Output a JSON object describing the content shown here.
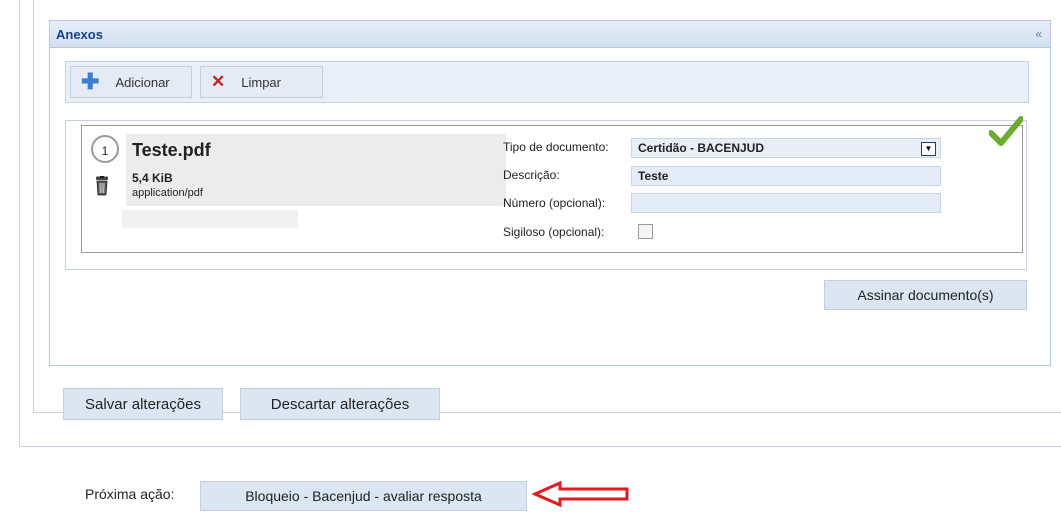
{
  "panel": {
    "title": "Anexos",
    "collapse_symbol": "«"
  },
  "toolbar": {
    "add_label": "Adicionar",
    "clear_label": "Limpar"
  },
  "file": {
    "index": "1",
    "name": "Teste.pdf",
    "size": "5,4 KiB",
    "mime": "application/pdf"
  },
  "form": {
    "doc_type_label": "Tipo de documento:",
    "doc_type_value": "Certidão - BACENJUD",
    "description_label": "Descrição:",
    "description_value": "Teste",
    "number_label": "Número (opcional):",
    "number_value": "",
    "secret_label": "Sigiloso (opcional):",
    "secret_checked": false
  },
  "actions": {
    "sign_label": "Assinar documento(s)",
    "save_label": "Salvar alterações",
    "discard_label": "Descartar alterações"
  },
  "next_action": {
    "label": "Próxima ação:",
    "button_label": "Bloqueio - Bacenjud - avaliar resposta"
  },
  "colors": {
    "panel_title": "#15428b",
    "success_check": "#6cab2f",
    "annotation_arrow": "#e01b24"
  },
  "icons": {
    "add": "plus-icon",
    "clear": "x-icon",
    "delete": "trash-icon",
    "status": "check-icon",
    "annotation": "arrow-left-icon"
  }
}
